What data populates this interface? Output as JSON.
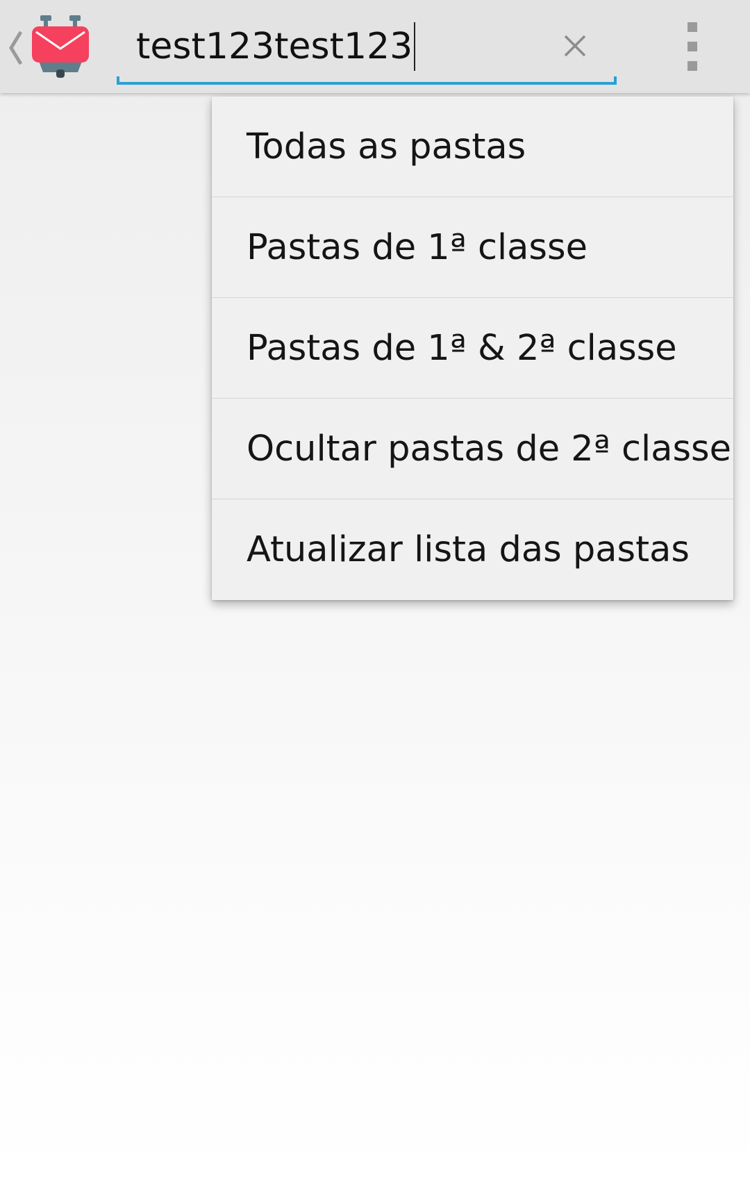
{
  "action_bar": {
    "up_icon": "chevron-left-icon",
    "app_icon": "k9-mail-icon",
    "search": {
      "value": "test123test123",
      "clear_icon": "close-icon",
      "underline_color": "#2aa0d4"
    },
    "overflow_icon": "more-vert-icon"
  },
  "dropdown_menu": {
    "items": [
      {
        "label": "Todas as pastas"
      },
      {
        "label": "Pastas de 1ª classe"
      },
      {
        "label": "Pastas de 1ª & 2ª classe"
      },
      {
        "label": "Ocultar pastas de 2ª classe"
      },
      {
        "label": "Atualizar lista das pastas"
      }
    ]
  }
}
